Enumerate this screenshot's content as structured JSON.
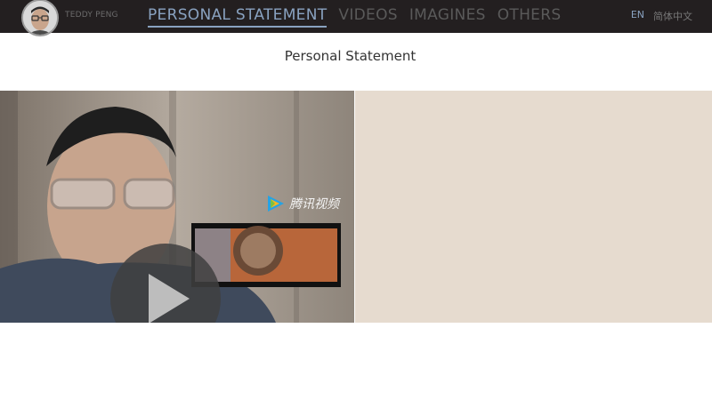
{
  "header": {
    "site_name": "TEDDY PENG",
    "nav": [
      {
        "label": "PERSONAL STATEMENT",
        "active": true
      },
      {
        "label": "VIDEOS",
        "active": false
      },
      {
        "label": "IMAGINES",
        "active": false
      },
      {
        "label": "OTHERS",
        "active": false
      }
    ],
    "lang": {
      "en": "EN",
      "zh": "简体中文"
    }
  },
  "main": {
    "title": "Personal Statement",
    "video": {
      "watermark": "腾讯视频"
    }
  },
  "colors": {
    "header_bg": "#231f20",
    "accent": "#89a2c0",
    "panel_bg": "#e6dbcf"
  }
}
